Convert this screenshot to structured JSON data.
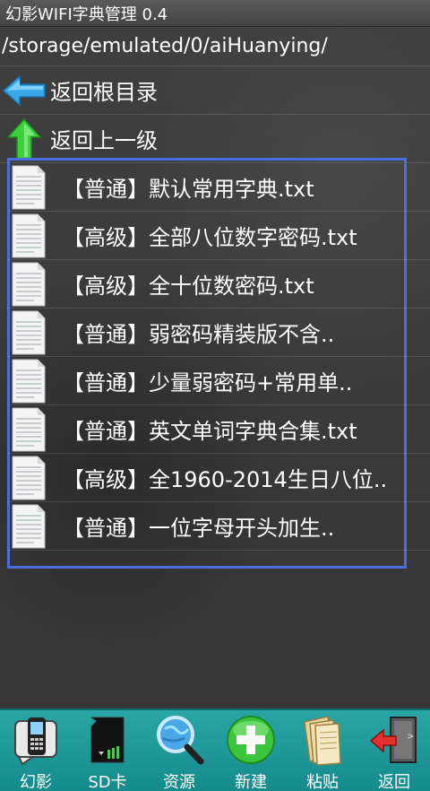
{
  "app": {
    "title": "幻影WIFI字典管理 0.4",
    "path": "/storage/emulated/0/aiHuanying/"
  },
  "nav": {
    "root_label": "返回根目录",
    "up_label": "返回上一级"
  },
  "files": [
    {
      "name": "【普通】默认常用字典.txt"
    },
    {
      "name": "【高级】全部八位数字密码.txt"
    },
    {
      "name": "【高级】全十位数密码.txt"
    },
    {
      "name": "【普通】弱密码精装版不含.."
    },
    {
      "name": "【普通】少量弱密码+常用单.."
    },
    {
      "name": "【普通】英文单词字典合集.txt"
    },
    {
      "name": "【高级】全1960-2014生日八位.."
    },
    {
      "name": "【普通】一位字母开头加生.."
    }
  ],
  "toolbar": {
    "items": [
      {
        "label": "幻影",
        "icon": "phone-icon"
      },
      {
        "label": "SD卡",
        "icon": "sd-card-icon"
      },
      {
        "label": "资源",
        "icon": "globe-search-icon"
      },
      {
        "label": "新建",
        "icon": "plus-icon"
      },
      {
        "label": "粘贴",
        "icon": "paste-icon"
      },
      {
        "label": "返回",
        "icon": "exit-icon"
      }
    ]
  },
  "colors": {
    "frame": "#4a6ee0",
    "toolbar": "#1f9a9c",
    "back_arrow": "#39a9e6",
    "up_arrow": "#3fcf3f"
  }
}
